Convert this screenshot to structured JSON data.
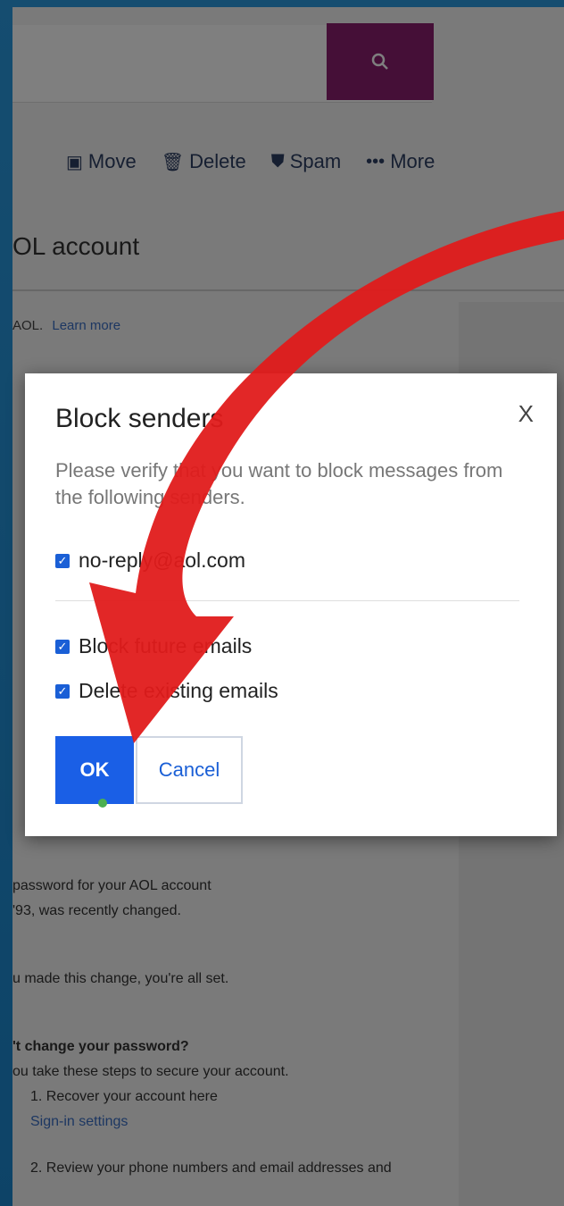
{
  "background": {
    "app": {
      "search_icon": "search-icon",
      "toolbar": [
        {
          "icon": "folder-icon",
          "glyph": "▣",
          "label": "Move"
        },
        {
          "icon": "trash-icon",
          "glyph": "🗑",
          "label": "Delete"
        },
        {
          "icon": "shield-icon",
          "glyph": "⛊",
          "label": "Spam"
        },
        {
          "icon": "more-icon",
          "glyph": "•••",
          "label": "More"
        }
      ],
      "subject": "OL account",
      "notice_text": "AOL.",
      "notice_link": "Learn more",
      "body": {
        "line1": "password for your AOL account",
        "line2": "'93, was recently changed.",
        "line3": "u made this change, you're all set.",
        "line4": "'t change your password?",
        "line5": "ou take these steps to secure your account.",
        "line6": "1. Recover your account here",
        "line7": "Sign-in settings",
        "line8": "2. Review your phone numbers and email addresses and"
      }
    }
  },
  "dialog": {
    "title": "Block senders",
    "close_label": "X",
    "message": "Please verify that you want to block messages from the following senders.",
    "sender_email": "no-reply@aol.com",
    "options": {
      "block_future": "Block future emails",
      "delete_existing": "Delete existing emails"
    },
    "ok_label": "OK",
    "cancel_label": "Cancel"
  },
  "colors": {
    "accent": "#1a5fe6",
    "search_button": "#8a1f6f",
    "arrow": "#e01b1b"
  }
}
